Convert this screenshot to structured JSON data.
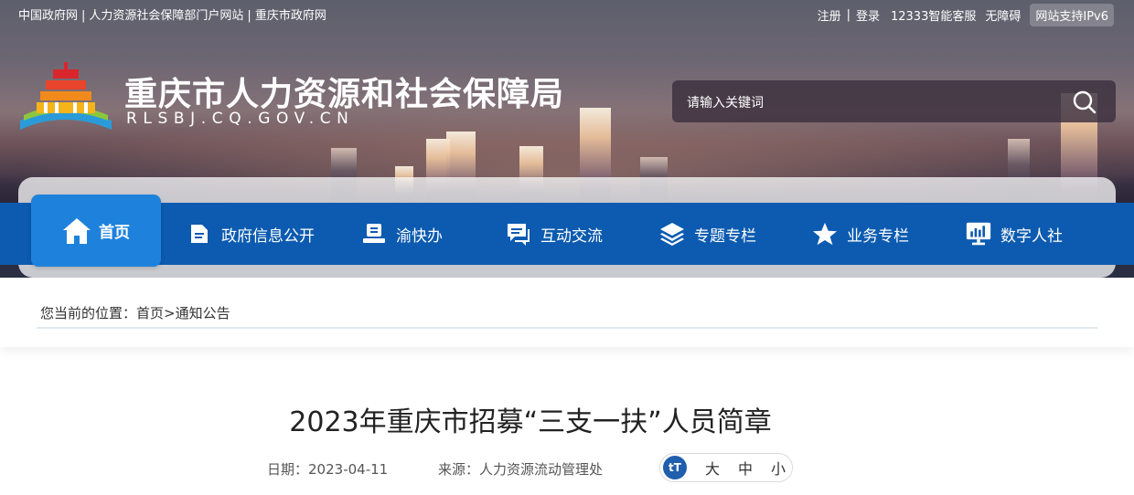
{
  "top_bar": {
    "left_links": [
      "中国政府网",
      "人力资源社会保障部门户网站",
      "重庆市政府网"
    ],
    "register": "注册",
    "login": "登录",
    "hotline": "12333智能客服",
    "accessibility": "无障碍",
    "ipv6_badge": "网站支持IPv6"
  },
  "header": {
    "site_title": "重庆市人力资源和社会保障局",
    "site_domain": "RLSBJ.CQ.GOV.CN",
    "logo_icon": "temple-emblem-icon"
  },
  "search": {
    "placeholder": "请输入关键词",
    "button_icon": "search-icon"
  },
  "nav": {
    "items": [
      {
        "label": "首页",
        "icon": "home-icon"
      },
      {
        "label": "政府信息公开",
        "icon": "document-icon"
      },
      {
        "label": "渝快办",
        "icon": "service-desk-icon"
      },
      {
        "label": "互动交流",
        "icon": "chat-icon"
      },
      {
        "label": "专题专栏",
        "icon": "layers-icon"
      },
      {
        "label": "业务专栏",
        "icon": "star-icon"
      },
      {
        "label": "数字人社",
        "icon": "monitor-chart-icon"
      }
    ]
  },
  "breadcrumb": {
    "prefix": "您当前的位置：",
    "home": "首页",
    "separator": ">",
    "current": "通知公告"
  },
  "article": {
    "title": "2023年重庆市招募“三支一扶”人员简章",
    "date_label": "日期：",
    "date": "2023-04-11",
    "source_label": "来源：",
    "source": "人力资源流动管理处",
    "font_size_icon": "tT",
    "font_sizes": [
      "大",
      "中",
      "小"
    ]
  },
  "colors": {
    "nav_blue": "#0c5bb0",
    "nav_active": "#1e82dc",
    "badge_blue": "#1f5fad"
  }
}
